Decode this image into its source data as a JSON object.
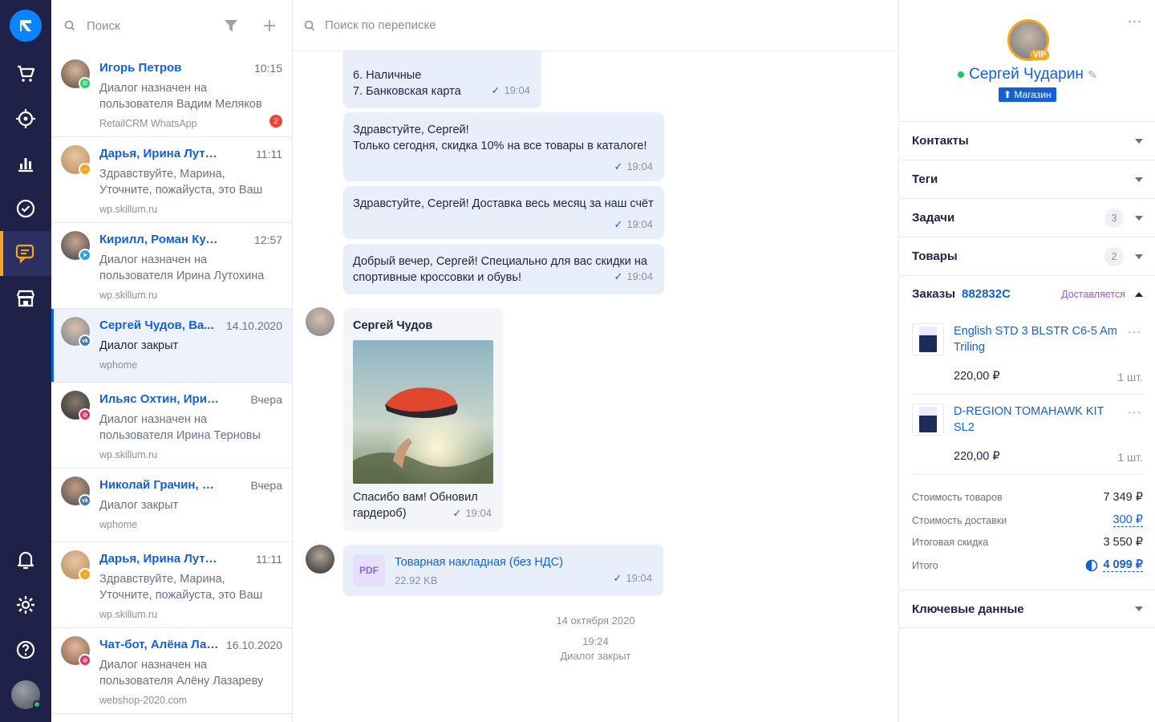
{
  "dialogs": {
    "search_placeholder": "Поиск",
    "items": [
      {
        "name": "Игорь Петров",
        "time": "10:15",
        "message": "Диалог назначен на пользователя Вадим Меляков",
        "source": "RetailCRM WhatsApp",
        "unread": "2",
        "channel": "whatsapp",
        "channel_color": "#25d366"
      },
      {
        "name": "Дарья, Ирина Лутохина",
        "time": "11:11",
        "message": "Здравствуйте, Марина, Уточните, пожайуста, это Ваш телефон с",
        "source": "wp.skillum.ru",
        "channel": "chat",
        "channel_color": "#f5a623"
      },
      {
        "name": "Кирилл, Роман Кудряшов",
        "time": "12:57",
        "message": "Диалог назначен на пользователя Ирина Лутохина",
        "source": "wp.skillum.ru",
        "channel": "telegram",
        "channel_color": "#2aa3df"
      },
      {
        "name": "Сергей Чудов, Ва...",
        "time": "14.10.2020",
        "message": "Диалог закрыт",
        "source": "wphome",
        "channel": "vk",
        "channel_color": "#4a76a8"
      },
      {
        "name": "Ильяс Охтин, Ирина Т...",
        "time": "Вчера",
        "message": "Диалог назначен на пользователя Ирина Терновы",
        "source": "wp.skillum.ru",
        "channel": "instagram",
        "channel_color": "#e1306c"
      },
      {
        "name": "Николай Грачин, Вад...",
        "time": "Вчера",
        "message": "Диалог закрыт",
        "source": "wphome",
        "channel": "vk",
        "channel_color": "#4a76a8"
      },
      {
        "name": "Дарья, Ирина Лутохина",
        "time": "11:11",
        "message": "Здравствуйте, Марина, Уточните, пожайуста, это Ваш телефон с",
        "source": "wp.skillum.ru",
        "channel": "chat",
        "channel_color": "#f5a623"
      },
      {
        "name": "Чат-бот, Алёна Лаз...",
        "time": "16.10.2020",
        "message": "Диалог назначен на пользователя Алёну Лазареву",
        "source": "webshop-2020.com",
        "channel": "instagram",
        "channel_color": "#e1306c"
      }
    ]
  },
  "chat": {
    "search_placeholder": "Поиск по переписке",
    "messages": [
      {
        "text_line1": "6. Наличные",
        "text_line2": "7. Банковская карта",
        "time": "19:04"
      },
      {
        "text_line1": "Здравстуйте, Сергей!",
        "text_line2": "Только сегодня, скидка 10% на все товары в каталоге!",
        "time": "19:04"
      },
      {
        "text": "Здравстуйте, Сергей! Доставка весь месяц за наш счёт",
        "time": "19:04"
      },
      {
        "text_line1": "Добрый вечер, Сергей! Специально для вас скидки на",
        "text_line2": "спортивные кроссовки и обувь!",
        "time": "19:04"
      }
    ],
    "incoming": {
      "author": "Сергей Чудов",
      "text_line1": "Спасибо вам! Обновил",
      "text_line2": "гардероб)",
      "time": "19:04"
    },
    "file": {
      "badge": "PDF",
      "name": "Товарная накладная (без НДС)",
      "size": "22.92 KB",
      "time": "19:04"
    },
    "date_note": "14 октября 2020",
    "close_time": "19:24",
    "close_note": "Диалог закрыт"
  },
  "panel": {
    "more": "...",
    "vip": "VIP",
    "customer_name": "Сергей Чударин",
    "shop_tag": "Магазин",
    "sections": {
      "contacts": "Контакты",
      "tags": "Теги",
      "tasks": "Задачи",
      "tasks_count": "3",
      "products": "Товары",
      "products_count": "2",
      "key_data": "Ключевые данные"
    },
    "orders": {
      "title": "Заказы",
      "number": "882832C",
      "status": "Доставляется",
      "items": [
        {
          "name": "English STD 3 BLSTR C6-5 Am Triling",
          "price": "220,00 ₽",
          "qty": "1 шт."
        },
        {
          "name": "D-REGION TOMAHAWK KIT SL2",
          "price": "220,00 ₽",
          "qty": "1 шт."
        }
      ],
      "summary": {
        "goods_label": "Стоимость товаров",
        "goods_value": "7 349 ₽",
        "delivery_label": "Стоимость доставки",
        "delivery_value": "300 ₽",
        "discount_label": "Итоговая скидка",
        "discount_value": "3 550 ₽",
        "total_label": "Итого",
        "total_value": "4 099 ₽"
      }
    }
  },
  "colors": {
    "nav_bg": "#1e2248",
    "accent": "#1361d4",
    "active_marker": "#f5a623"
  }
}
